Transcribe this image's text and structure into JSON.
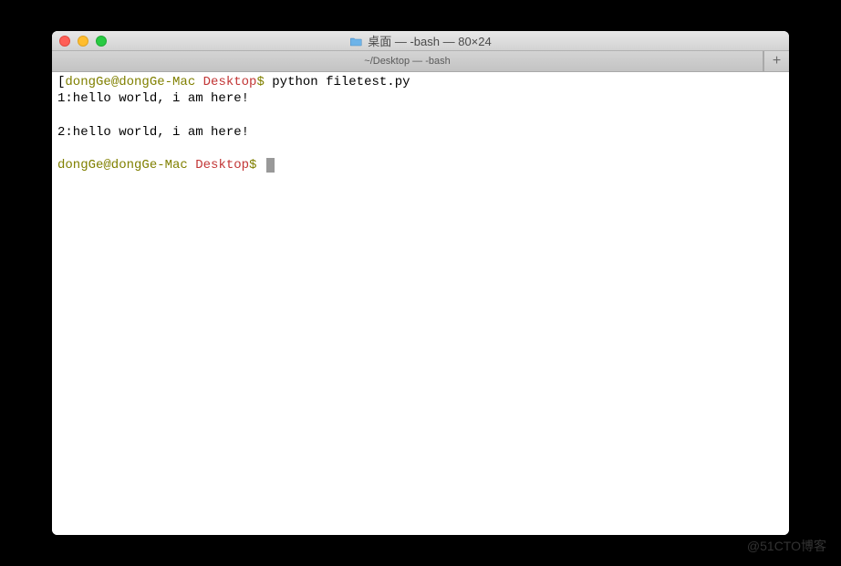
{
  "window": {
    "title": "桌面 — -bash — 80×24"
  },
  "tab": {
    "label": "~/Desktop — -bash"
  },
  "prompt": {
    "user_host": "dongGe@dongGe-Mac",
    "directory": "Desktop",
    "symbol": "$"
  },
  "terminal": {
    "command1": "python filetest.py",
    "output1": "1:hello world, i am here!",
    "output2": "2:hello world, i am here!"
  },
  "watermark": "@51CTO博客"
}
